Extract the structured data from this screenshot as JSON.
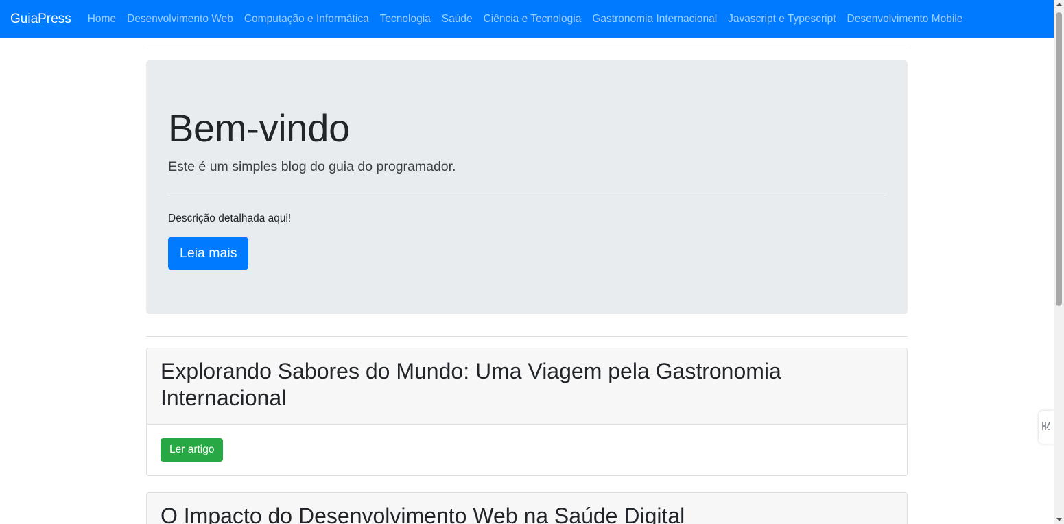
{
  "navbar": {
    "brand": "GuiaPress",
    "links": [
      "Home",
      "Desenvolvimento Web",
      "Computação e Informática",
      "Tecnologia",
      "Saúde",
      "Ciência e Tecnologia",
      "Gastronomia Internacional",
      "Javascript e Typescript",
      "Desenvolvimento Mobile"
    ]
  },
  "jumbotron": {
    "title": "Bem-vindo",
    "lead": "Este é um simples blog do guia do programador.",
    "description": "Descrição detalhada aqui!",
    "button_label": "Leia mais"
  },
  "articles": [
    {
      "title": "Explorando Sabores do Mundo: Uma Viagem pela Gastronomia Internacional",
      "button_label": "Ler artigo"
    },
    {
      "title": "O Impacto do Desenvolvimento Web na Saúde Digital"
    }
  ],
  "colors": {
    "primary": "#007bff",
    "success": "#28a745",
    "jumbotron_bg": "#e9ecef",
    "card_header_bg": "#f7f7f7"
  },
  "icons": {
    "side_widget": "translate-icon"
  }
}
